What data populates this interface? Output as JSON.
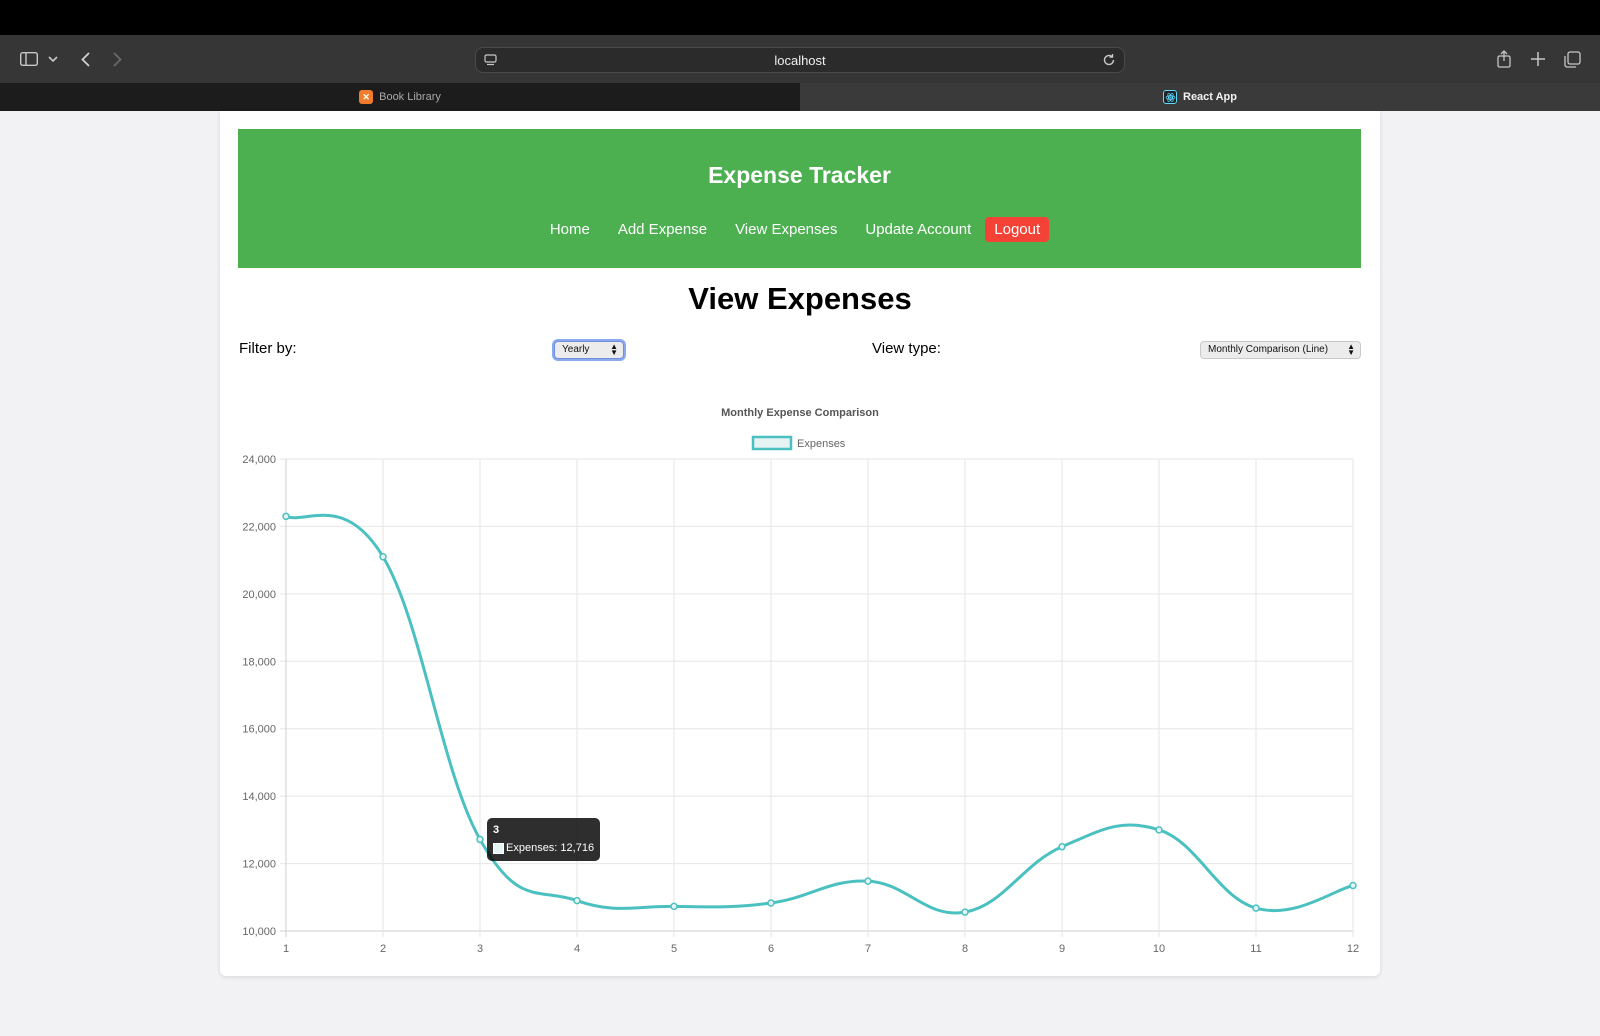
{
  "browser": {
    "url": "localhost",
    "tabs": [
      {
        "label": "Book Library",
        "active": false,
        "favicon": "xampp-icon",
        "favicon_color": "#f07c2c"
      },
      {
        "label": "React App",
        "active": true,
        "favicon": "react-icon",
        "favicon_color": "#61dafb"
      }
    ]
  },
  "app": {
    "title": "Expense Tracker",
    "nav": {
      "home": "Home",
      "add_expense": "Add Expense",
      "view_expenses": "View Expenses",
      "update_account": "Update Account",
      "logout": "Logout"
    },
    "colors": {
      "header": "#4caf50",
      "logout": "#f44336",
      "series": "#4bc0c0"
    }
  },
  "page": {
    "title": "View Expenses",
    "filter_label": "Filter by:",
    "filter_value": "Yearly",
    "view_type_label": "View type:",
    "view_type_value": "Monthly Comparison (Line)"
  },
  "tooltip": {
    "title": "3",
    "body": "Expenses: 12,716"
  },
  "chart_data": {
    "type": "line",
    "title": "Monthly Expense Comparison",
    "xlabel": "",
    "ylabel": "",
    "x": [
      1,
      2,
      3,
      4,
      5,
      6,
      7,
      8,
      9,
      10,
      11,
      12
    ],
    "series": [
      {
        "name": "Expenses",
        "values": [
          22300,
          21100,
          12716,
          10900,
          10730,
          10830,
          11480,
          10560,
          12500,
          13000,
          10680,
          11350
        ]
      }
    ],
    "ylim": [
      10000,
      24000
    ],
    "yticks": [
      "10,000",
      "12,000",
      "14,000",
      "16,000",
      "18,000",
      "20,000",
      "22,000",
      "24,000"
    ],
    "xticks": [
      "1",
      "2",
      "3",
      "4",
      "5",
      "6",
      "7",
      "8",
      "9",
      "10",
      "11",
      "12"
    ],
    "grid": true,
    "legend": "top-center"
  }
}
